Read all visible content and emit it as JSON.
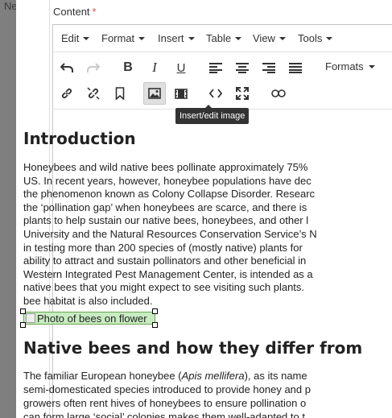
{
  "background": {
    "partial_text": "Ne"
  },
  "field": {
    "label": "Content",
    "required_mark": "*"
  },
  "menubar": {
    "items": [
      "Edit",
      "Format",
      "Insert",
      "Table",
      "View",
      "Tools"
    ]
  },
  "toolbar": {
    "formats_label": "Formats"
  },
  "tooltip": {
    "text": "Insert/edit image"
  },
  "content": {
    "heading1": "Introduction",
    "paragraph1": [
      "Honeybees and wild native bees pollinate approximately 75%",
      "US. In recent years, however, honeybee populations have dec",
      "the phenomenon known as Colony Collapse Disorder. Researc",
      "the ‘pollination gap’ when honeybees are scarce, and there is",
      "plants to help sustain our native bees, honeybees, and other l",
      "University and the Natural Resources Conservation Service’s N",
      "in testing more than 200 species of (mostly native) plants for",
      "ability to attract and sustain pollinators and other beneficial in",
      "Western Integrated Pest Management Center, is intended as a",
      "native bees that you might expect to see visiting such plants.",
      "bee habitat is also included."
    ],
    "image_alt": "Photo of bees on flower",
    "heading2": "Native bees and how they differ from",
    "paragraph2_lines": [
      {
        "before": "The familiar European honeybee (",
        "italic": "Apis mellifera",
        "after": "), as its name"
      },
      {
        "before": "semi-domesticated species introduced to provide honey and p",
        "italic": "",
        "after": ""
      },
      {
        "before": "growers often rent hives of honeybees to ensure pollination o",
        "italic": "",
        "after": ""
      },
      {
        "before": "can form large ‘social’ colonies makes them well-adapted to t",
        "italic": "",
        "after": ""
      }
    ]
  }
}
